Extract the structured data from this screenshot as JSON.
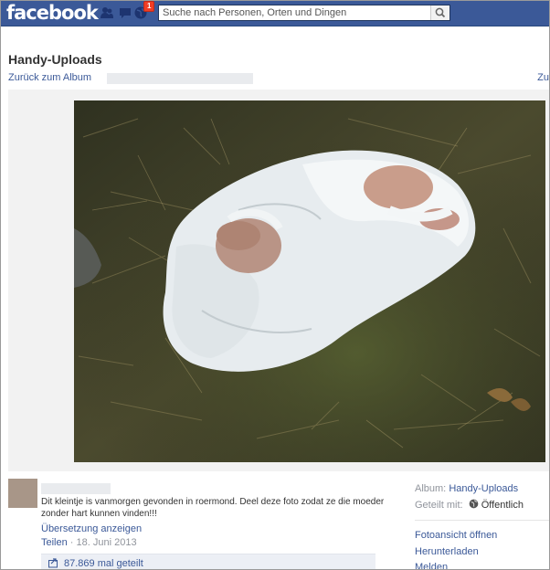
{
  "header": {
    "logo": "facebook",
    "notification_count": "1",
    "search": {
      "placeholder": "Suche nach Personen, Orten und Dingen"
    }
  },
  "album": {
    "title": "Handy-Uploads",
    "back_link": "Zurück zum Album",
    "nav_right": "Zu"
  },
  "post": {
    "caption": "Dit kleintje is vanmorgen gevonden in roermond. Deel deze foto zodat ze die moeder zonder hart kunnen vinden!!!",
    "translate_link": "Übersetzung anzeigen",
    "share_link": "Teilen",
    "separator": " · ",
    "date": "18. Juni 2013",
    "share_count_text": "87.869 mal geteilt"
  },
  "sidebar": {
    "album_label": "Album:",
    "album_value": "Handy-Uploads",
    "shared_label": "Geteilt mit:",
    "shared_value": "Öffentlich",
    "links": [
      "Fotoansicht öffnen",
      "Herunterladen",
      "Melden"
    ]
  },
  "colors": {
    "brand": "#3b5998",
    "link": "#3b5998",
    "badge": "#f03d25"
  },
  "icons": [
    "friends-icon",
    "messages-icon",
    "globe-notifications-icon",
    "search-icon",
    "share-icon",
    "globe-icon"
  ]
}
